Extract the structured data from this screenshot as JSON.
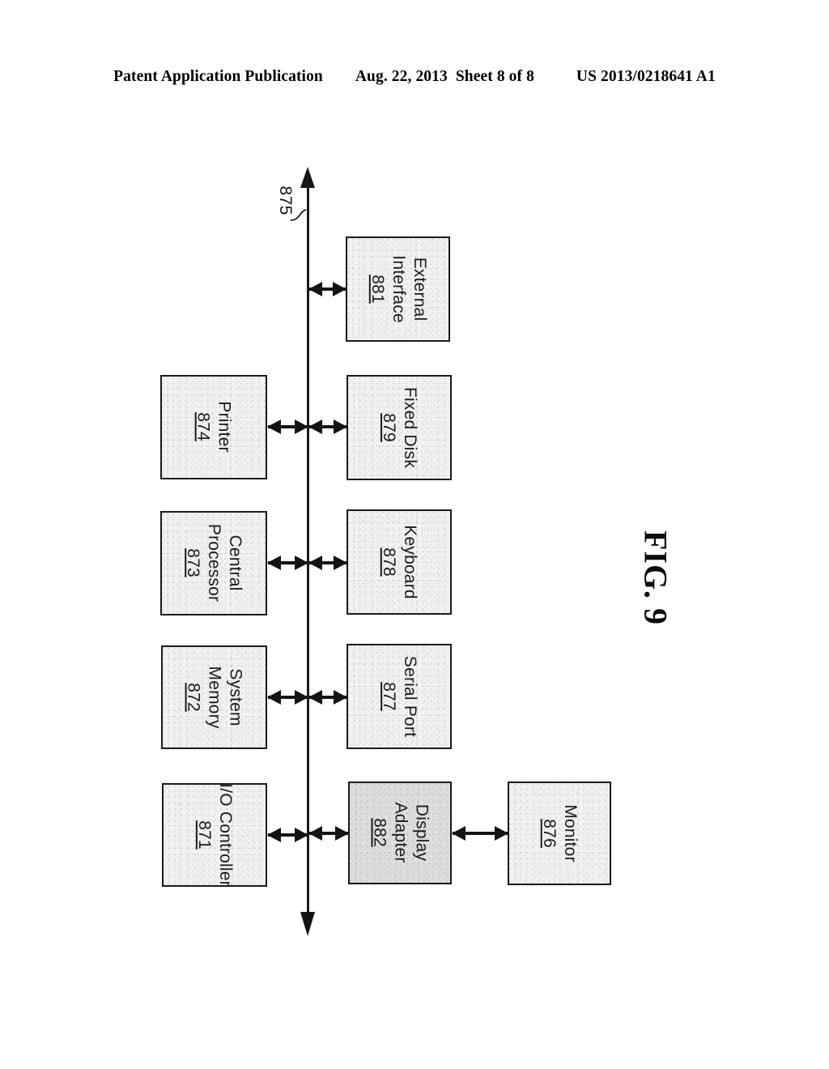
{
  "header": {
    "publication": "Patent Application Publication",
    "date": "Aug. 22, 2013",
    "sheet": "Sheet 8 of 8",
    "patent_number": "US 2013/0218641 A1"
  },
  "figure": {
    "caption": "FIG. 9",
    "bus": {
      "reference_numeral": "875",
      "orientation": "vertical",
      "double_ended": true
    },
    "blocks": [
      {
        "id": "io-controller",
        "label": "I/O Controller",
        "label_line2": "",
        "numeral": "871",
        "side": "left"
      },
      {
        "id": "system-memory",
        "label": "System",
        "label_line2": "Memory",
        "numeral": "872",
        "side": "left"
      },
      {
        "id": "central-processor",
        "label": "Central",
        "label_line2": "Processor",
        "numeral": "873",
        "side": "left"
      },
      {
        "id": "printer",
        "label": "Printer",
        "label_line2": "",
        "numeral": "874",
        "side": "left"
      },
      {
        "id": "display-adapter",
        "label": "Display",
        "label_line2": "Adapter",
        "numeral": "882",
        "side": "right"
      },
      {
        "id": "serial-port",
        "label": "Serial Port",
        "label_line2": "",
        "numeral": "877",
        "side": "right"
      },
      {
        "id": "keyboard",
        "label": "Keyboard",
        "label_line2": "",
        "numeral": "878",
        "side": "right"
      },
      {
        "id": "fixed-disk",
        "label": "Fixed Disk",
        "label_line2": "",
        "numeral": "879",
        "side": "right"
      },
      {
        "id": "external-interface",
        "label": "External",
        "label_line2": "Interface",
        "numeral": "881",
        "side": "right"
      },
      {
        "id": "monitor",
        "label": "Monitor",
        "label_line2": "",
        "numeral": "876",
        "side": "far-right"
      }
    ]
  }
}
